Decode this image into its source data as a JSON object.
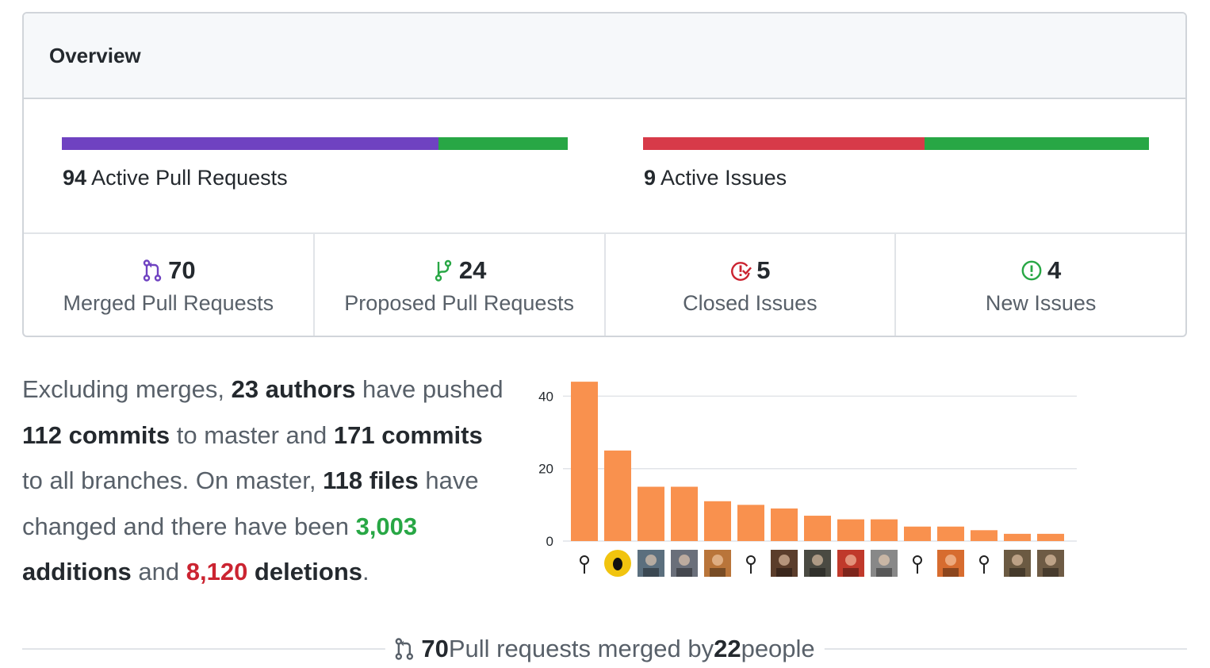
{
  "overview": {
    "title": "Overview",
    "pull_requests": {
      "count": "94",
      "label": "Active Pull Requests",
      "bar_fraction_merged": 0.745,
      "merged_color": "#6f42c1",
      "proposed_color": "#28a745"
    },
    "issues": {
      "count": "9",
      "label": "Active Issues",
      "bar_fraction_closed": 0.556,
      "closed_color": "#d73a49",
      "new_color": "#28a745"
    },
    "stats": [
      {
        "value": "70",
        "label": "Merged Pull Requests",
        "icon": "git-merge-icon",
        "color": "#6f42c1"
      },
      {
        "value": "24",
        "label": "Proposed Pull Requests",
        "icon": "git-branch-icon",
        "color": "#28a745"
      },
      {
        "value": "5",
        "label": "Closed Issues",
        "icon": "issue-closed-icon",
        "color": "#cb2431"
      },
      {
        "value": "4",
        "label": "New Issues",
        "icon": "issue-opened-icon",
        "color": "#28a745"
      }
    ]
  },
  "commits_summary": {
    "t1": "Excluding merges, ",
    "authors": "23 authors",
    "t2": " have pushed ",
    "commits_master": "112 commits",
    "t3": " to master and ",
    "commits_all": "171 commits",
    "t4": " to all branches. On master, ",
    "files": "118 files",
    "t5": " have changed and there have been ",
    "additions_num": "3,003",
    "additions_word": " additions",
    "t6": " and ",
    "deletions_num": "8,120",
    "deletions_word": " deletions",
    "t7": "."
  },
  "chart_data": {
    "type": "bar",
    "values": [
      44,
      25,
      15,
      15,
      11,
      10,
      9,
      7,
      6,
      6,
      4,
      4,
      3,
      2,
      2
    ],
    "ylim": [
      0,
      46
    ],
    "yticks": [
      0,
      20,
      40
    ],
    "bar_color": "#f9914e",
    "grid": true,
    "avatar_colors": [
      "#ffffff",
      "#f1c40f",
      "#5b6f7e",
      "#6a6f7a",
      "#b9753a",
      "#ffffff",
      "#5b3d2b",
      "#4a4a42",
      "#c0392b",
      "#888888",
      "#ffffff",
      "#d76c2f",
      "#ffffff",
      "#6b5a42",
      "#6e5b45"
    ]
  },
  "footer": {
    "merged_count": "70",
    "text1": " Pull requests merged by ",
    "people_count": "22",
    "text2": " people"
  }
}
